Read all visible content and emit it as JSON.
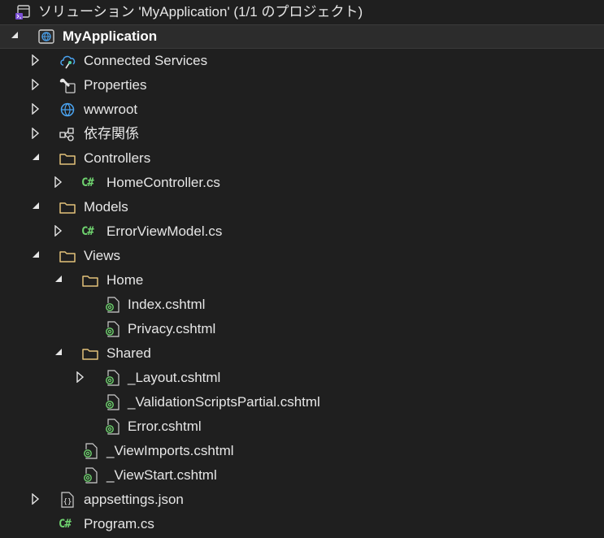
{
  "solution": {
    "label": "ソリューション 'MyApplication' (1/1 のプロジェクト)"
  },
  "project": {
    "label": "MyApplication"
  },
  "nodes": {
    "connected_services": "Connected Services",
    "properties": "Properties",
    "wwwroot": "wwwroot",
    "dependencies": "依存関係",
    "controllers": "Controllers",
    "home_controller": "HomeController.cs",
    "models": "Models",
    "error_view_model": "ErrorViewModel.cs",
    "views": "Views",
    "home_folder": "Home",
    "index_view": "Index.cshtml",
    "privacy_view": "Privacy.cshtml",
    "shared_folder": "Shared",
    "layout_view": "_Layout.cshtml",
    "validation_partial": "_ValidationScriptsPartial.cshtml",
    "error_view": "Error.cshtml",
    "view_imports": "_ViewImports.cshtml",
    "view_start": "_ViewStart.cshtml",
    "appsettings": "appsettings.json",
    "program": "Program.cs"
  },
  "icons": {
    "cs_glyph": "C#",
    "json_glyph": "{}"
  },
  "colors": {
    "background": "#1f1f1f",
    "folder": "#e3c27a",
    "csharp": "#6fd36f",
    "razor": "#6fd36f",
    "globe": "#4aa3f0",
    "text": "#e6e6e6"
  }
}
